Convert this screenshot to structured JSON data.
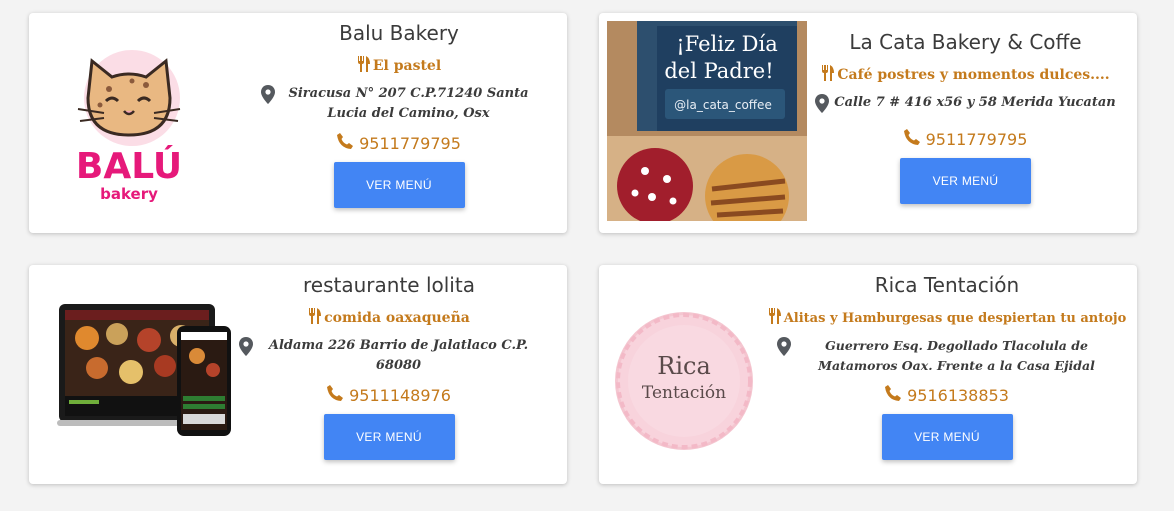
{
  "restaurants": [
    {
      "name": "Balu Bakery",
      "tagline": "El pastel",
      "address": "Siracusa N° 207 C.P.71240 Santa Lucia del Camino, Osx",
      "phone": "9511779795",
      "button": "VER MENÚ",
      "logo_text": "BALÚ",
      "logo_sub": "bakery"
    },
    {
      "name": "La Cata Bakery & Coffe",
      "tagline": "Café postres y momentos dulces....",
      "address": "Calle 7 # 416 x56 y 58 Merida Yucatan",
      "phone": "9511779795",
      "button": "VER MENÚ",
      "image_line1": "¡Feliz Día",
      "image_line2": "del Padre!",
      "image_handle": "@la_cata_coffee"
    },
    {
      "name": "restaurante lolita",
      "tagline": "comida oaxaqueña",
      "address": "Aldama 226 Barrio de Jalatlaco C.P. 68080",
      "phone": "9511148976",
      "button": "VER MENÚ"
    },
    {
      "name": "Rica Tentación",
      "tagline": "Alitas y Hamburgesas que despiertan tu antojo",
      "address": "Guerrero Esq. Degollado Tlacolula de Matamoros Oax. Frente a la Casa Ejidal",
      "phone": "9516138853",
      "button": "VER MENÚ",
      "logo_line1": "Rica",
      "logo_line2": "Tentación"
    }
  ],
  "icons": {
    "tagline": "utensils-icon",
    "address": "map-marker-icon",
    "phone": "phone-icon"
  },
  "colors": {
    "accent": "#c47a1c",
    "button": "#4285f4",
    "text": "#3b3b3b"
  }
}
